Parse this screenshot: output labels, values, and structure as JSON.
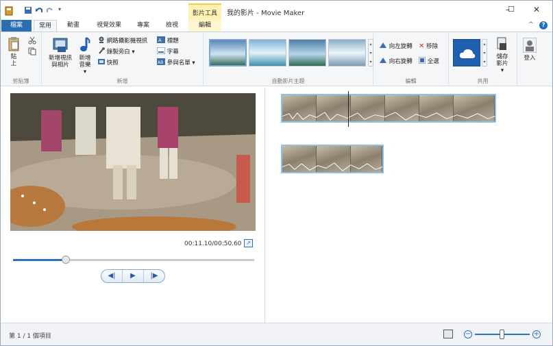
{
  "window": {
    "title": "我的影片 - Movie Maker",
    "context_tab": "影片工具",
    "controls": {
      "minimize": "–",
      "maximize": "☐",
      "close": "✕"
    }
  },
  "tabs": {
    "file": "檔案",
    "items": [
      "常用",
      "動畫",
      "視覺效果",
      "專案",
      "檢視",
      "編輯"
    ],
    "active": "常用",
    "collapse": "^",
    "help": "?"
  },
  "ribbon": {
    "clipboard": {
      "label": "剪貼簿",
      "paste": "貼上"
    },
    "add": {
      "label": "新增",
      "add_video_photo": "新增視訊與相片",
      "add_music": "新增音樂",
      "webcam_video": "網路攝影機視訊",
      "record_narration": "錄製旁白",
      "snapshot": "快照",
      "title": "標題",
      "caption": "字幕",
      "credits": "參與名單"
    },
    "themes": {
      "label": "自動影片主題"
    },
    "editing": {
      "label": "編輯",
      "rotate_left": "向左旋轉",
      "remove": "移除",
      "rotate_right": "向右旋轉",
      "select_all": "全選"
    },
    "share": {
      "label": "共用",
      "save_movie": "儲存影片"
    },
    "sign_in": "登入"
  },
  "preview": {
    "timecode": "00:11.10/00:50.60",
    "progress": 0.22
  },
  "status": {
    "text": "第 1 / 1 個項目"
  },
  "zoom": {
    "level": 0.5
  },
  "colors": {
    "accent": "#2a72c0",
    "file_tab": "#2a6db0",
    "context_tab": "#fdf2b4",
    "clip_border": "#8ec1ea"
  }
}
